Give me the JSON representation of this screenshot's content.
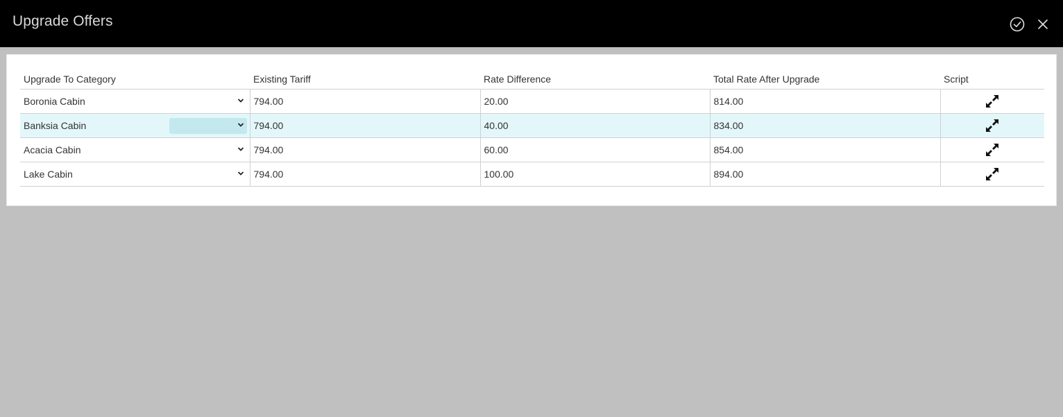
{
  "window": {
    "title": "Upgrade Offers"
  },
  "table": {
    "headers": [
      "Upgrade To Category",
      "Existing Tariff",
      "Rate Difference",
      "Total Rate After Upgrade",
      "Script"
    ],
    "rows": [
      {
        "category": "Boronia Cabin",
        "existing_tariff": "794.00",
        "rate_difference": "20.00",
        "total_rate": "814.00"
      },
      {
        "category": "Banksia Cabin",
        "existing_tariff": "794.00",
        "rate_difference": "40.00",
        "total_rate": "834.00"
      },
      {
        "category": "Acacia Cabin",
        "existing_tariff": "794.00",
        "rate_difference": "60.00",
        "total_rate": "854.00"
      },
      {
        "category": "Lake Cabin",
        "existing_tariff": "794.00",
        "rate_difference": "100.00",
        "total_rate": "894.00"
      }
    ],
    "selected_row": 1
  },
  "icons": {
    "confirm": "check-circle-icon",
    "close": "close-icon",
    "dropdown": "chevron-down-icon",
    "script": "expand-icon"
  },
  "colors": {
    "header_bg": "#000000",
    "page_bg": "#c0c0c0",
    "selected_row": "#e3f7fa",
    "selected_chevron_bg": "#c3e9ef"
  }
}
